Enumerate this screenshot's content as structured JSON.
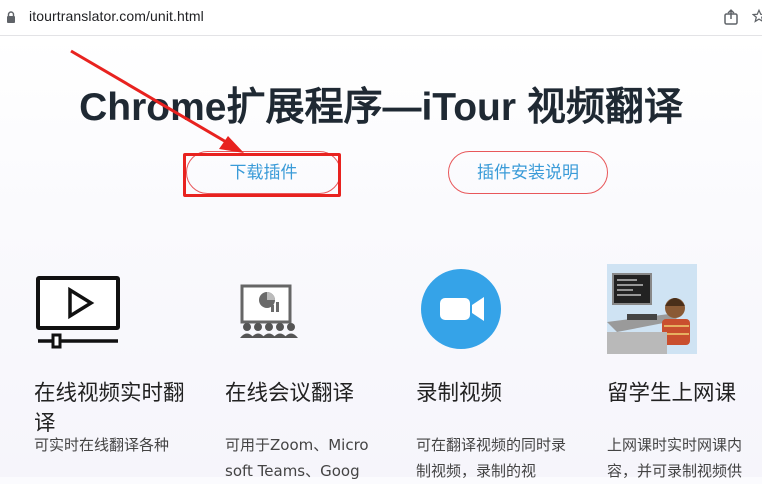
{
  "browser": {
    "url": "itourtranslator.com/unit.html"
  },
  "hero": {
    "title": "Chrome扩展程序—iTour 视频翻译",
    "download_button": "下载插件",
    "guide_button": "插件安装说明"
  },
  "features": [
    {
      "icon": "video-player-icon",
      "title": "在线视频实时翻译",
      "desc": "可实时在线翻译各种"
    },
    {
      "icon": "meeting-icon",
      "title": "在线会议翻译",
      "desc": "可用于Zoom、Microsoft Teams、Goog"
    },
    {
      "icon": "camera-icon",
      "title": "录制视频",
      "desc": "可在翻译视频的同时录制视频，录制的视"
    },
    {
      "icon": "student-computer-icon",
      "title": "留学生上网课",
      "desc": "上网课时实时网课内容，并可录制视频供"
    }
  ],
  "colors": {
    "accent_blue": "#3a9bd8",
    "button_border": "#e8575a",
    "annotation_red": "#e8221f",
    "camera_blue": "#35a3e8"
  }
}
